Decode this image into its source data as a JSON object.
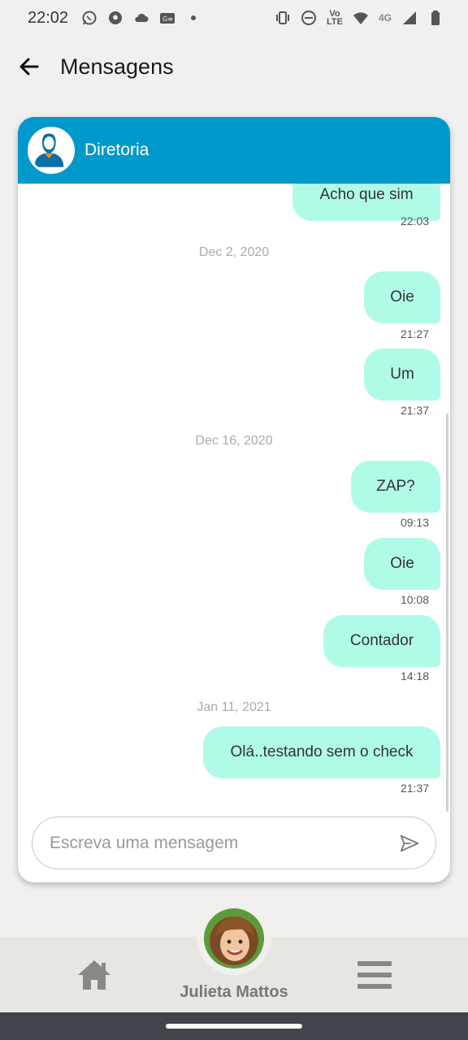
{
  "status_bar": {
    "time": "22:02",
    "lte_label_top": "Vo",
    "lte_label_bottom": "LTE",
    "network_label": "4G"
  },
  "header": {
    "title": "Mensagens"
  },
  "chat": {
    "contact_name": "Diretoria",
    "messages": [
      {
        "text": "Acho que sim",
        "time": "22:03"
      },
      {
        "date": "Dec 2, 2020"
      },
      {
        "text": "Oie",
        "time": "21:27"
      },
      {
        "text": "Um",
        "time": "21:37"
      },
      {
        "date": "Dec 16, 2020"
      },
      {
        "text": "ZAP?",
        "time": "09:13"
      },
      {
        "text": "Oie",
        "time": "10:08"
      },
      {
        "text": "Contador",
        "time": "14:18"
      },
      {
        "date": "Jan 11, 2021"
      },
      {
        "text": "Olá..testando sem o check",
        "time": "21:37"
      }
    ],
    "input_placeholder": "Escreva uma mensagem"
  },
  "bottom_nav": {
    "user_name": "Julieta Mattos"
  },
  "colors": {
    "accent": "#0099cc",
    "bubble": "#b0fbe8"
  },
  "icons": [
    "back-arrow-icon",
    "send-icon",
    "home-icon",
    "menu-icon"
  ]
}
